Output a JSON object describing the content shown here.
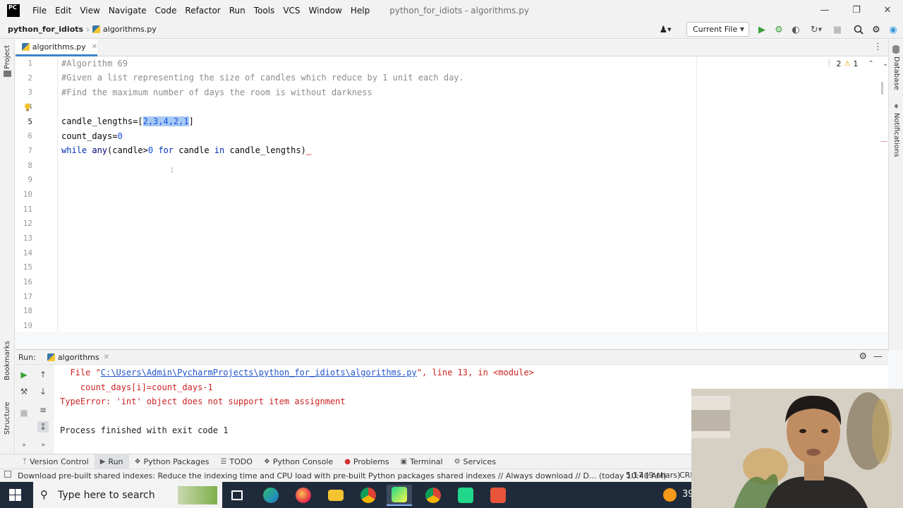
{
  "menubar": {
    "logo": "PC",
    "items": [
      "File",
      "Edit",
      "View",
      "Navigate",
      "Code",
      "Refactor",
      "Run",
      "Tools",
      "VCS",
      "Window",
      "Help"
    ],
    "window_title": "python_for_idiots - algorithms.py"
  },
  "navbar": {
    "project": "python_for_idiots",
    "file": "algorithms.py",
    "run_config": "Current File"
  },
  "left_strip": {
    "project_label": "Project",
    "bookmarks_label": "Bookmarks",
    "structure_label": "Structure"
  },
  "right_strip": {
    "database_label": "Database",
    "notifications_label": "Notifications"
  },
  "editor": {
    "tab_label": "algorithms.py",
    "inspections": {
      "errors": "2",
      "warnings": "1"
    },
    "line_numbers": [
      "1",
      "2",
      "3",
      "4",
      "5",
      "6",
      "7",
      "8",
      "9",
      "10",
      "11",
      "12",
      "13",
      "14",
      "15",
      "16",
      "17",
      "18",
      "19"
    ],
    "lines": {
      "l1": "#Algorithm 69",
      "l2": "#Given a list representing the size of candles which reduce by 1 unit each day.",
      "l3": "#Find the maximum number of days the room is without darkness",
      "l5_pre": "candle_lengths=[",
      "l5_sel": "2,3,4,2,1",
      "l5_post": "]",
      "l6_pre": "count_days=",
      "l6_num": "0",
      "l7_while": "while ",
      "l7_any": "any",
      "l7_a": "(candle>",
      "l7_zero": "0",
      "l7_sp": " ",
      "l7_for": "for",
      "l7_b": " candle ",
      "l7_in": "in",
      "l7_c": " candle_lengths)"
    }
  },
  "run_panel": {
    "label": "Run:",
    "tab": "algorithms",
    "console": {
      "c1_pre": "  File \"",
      "c1_link": "C:\\Users\\Admin\\PycharmProjects\\python_for_idiots\\algorithms.py",
      "c1_post": "\", line 13, in <module>",
      "c2": "    count_days[i]=count_days-1",
      "c3": "TypeError: 'int' object does not support item assignment",
      "c4": "Process finished with exit code 1"
    }
  },
  "tool_tabs": [
    "Version Control",
    "Run",
    "Python Packages",
    "TODO",
    "Python Console",
    "Problems",
    "Terminal",
    "Services"
  ],
  "statusbar": {
    "message": "Download pre-built shared indexes: Reduce the indexing time and CPU load with pre-built Python packages shared indexes // Always download // D... (today 10:40 AM)",
    "position": "5:17 (9 chars)",
    "line_sep": "CRL"
  },
  "taskbar": {
    "search_placeholder": "Type here to search",
    "tray_text": "39"
  },
  "colors": {
    "accent": "#4083c9",
    "error": "#cc2222",
    "link": "#2255cc",
    "selection": "#a6c9f2",
    "taskbar": "#1f2a3a"
  }
}
